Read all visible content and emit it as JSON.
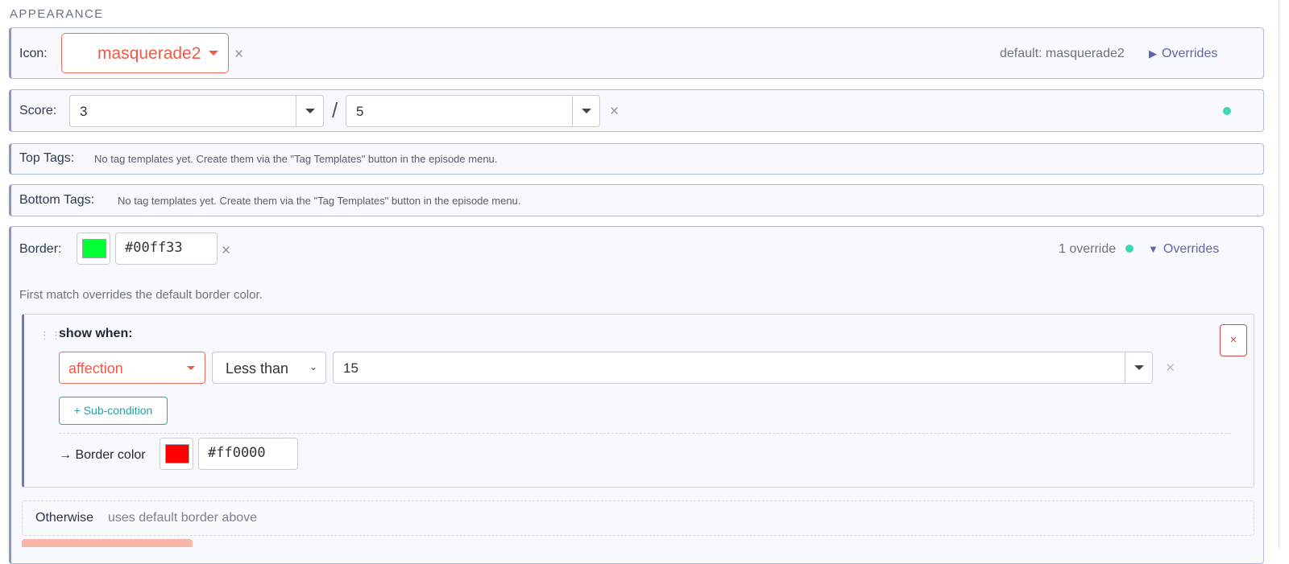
{
  "section": {
    "title": "APPEARANCE"
  },
  "icon_row": {
    "label": "Icon:",
    "value": "masquerade2",
    "clear": "×",
    "default_text": "default: masquerade2",
    "overrides_label": "Overrides",
    "overrides_icon": "triangle-right-icon"
  },
  "score_row": {
    "label": "Score:",
    "value": "3",
    "separator": "/",
    "max": "5",
    "clear": "×"
  },
  "top_tags": {
    "label": "Top Tags:",
    "hint": "No tag templates yet. Create them via the \"Tag Templates\" button in the episode menu."
  },
  "bottom_tags": {
    "label": "Bottom Tags:",
    "hint": "No tag templates yet. Create them via the \"Tag Templates\" button in the episode menu."
  },
  "border_row": {
    "label": "Border:",
    "color": "#00ff33",
    "hex": "#00ff33",
    "clear": "×",
    "override_count": "1 override",
    "overrides_label": "Overrides",
    "overrides_icon": "triangle-down-icon",
    "description": "First match overrides the default border color.",
    "rule": {
      "show_when": "show when:",
      "field": "affection",
      "operator": "Less than",
      "value": "15",
      "clear": "×",
      "sub_condition": "+ Sub-condition",
      "result_label": "→ Border color",
      "result_color": "#ff0000",
      "result_hex": "#ff0000",
      "delete": "×"
    },
    "otherwise": {
      "label": "Otherwise",
      "text": "uses default border above"
    }
  },
  "colors": {
    "accent": "#5b68a8",
    "error": "#ef5a48",
    "teal": "#2a9ea2",
    "status_dot": "#3fd6b4"
  }
}
